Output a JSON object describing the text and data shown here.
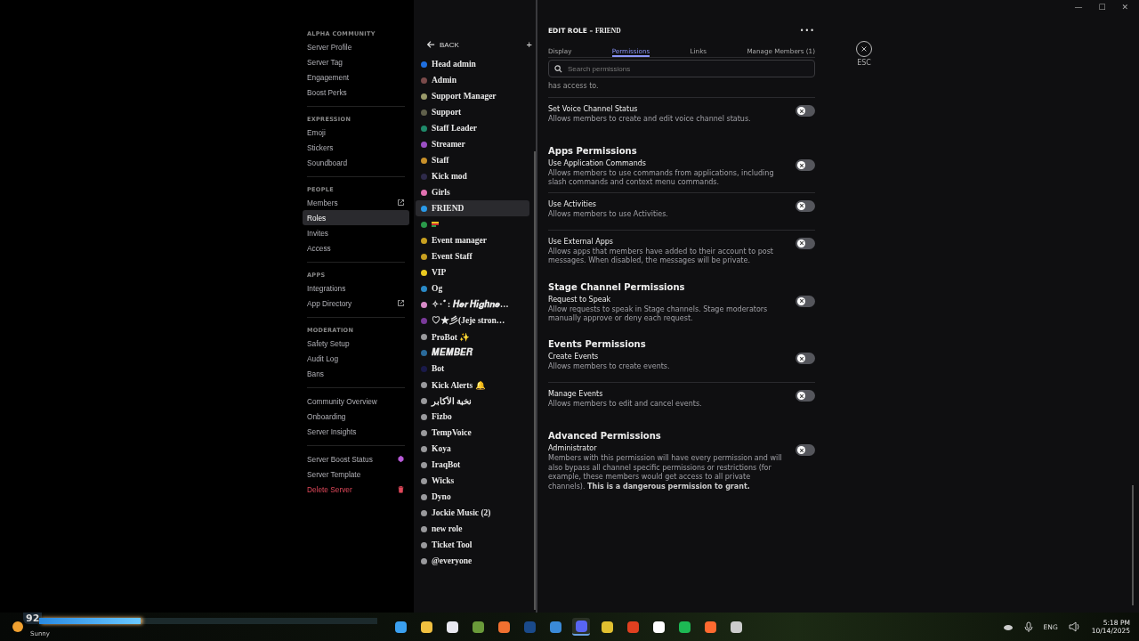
{
  "window_controls": [
    "—",
    "☐",
    "✕"
  ],
  "settings_nav": [
    {
      "header": "ALPHA COMMUNITY",
      "items": [
        {
          "label": "Server Profile",
          "kind": "link",
          "selected": false
        },
        {
          "label": "Server Tag",
          "kind": "link",
          "selected": false
        },
        {
          "label": "Engagement",
          "kind": "link",
          "selected": false
        },
        {
          "label": "Boost Perks",
          "kind": "link",
          "selected": false
        }
      ]
    },
    {
      "header": "EXPRESSION",
      "items": [
        {
          "label": "Emoji",
          "kind": "link",
          "selected": false
        },
        {
          "label": "Stickers",
          "kind": "link",
          "selected": false
        },
        {
          "label": "Soundboard",
          "kind": "link",
          "selected": false
        }
      ]
    },
    {
      "header": "PEOPLE",
      "items": [
        {
          "label": "Members",
          "kind": "external",
          "selected": false
        },
        {
          "label": "Roles",
          "kind": "link",
          "selected": true
        },
        {
          "label": "Invites",
          "kind": "link",
          "selected": false
        },
        {
          "label": "Access",
          "kind": "link",
          "selected": false
        }
      ]
    },
    {
      "header": "APPS",
      "items": [
        {
          "label": "Integrations",
          "kind": "link",
          "selected": false
        },
        {
          "label": "App Directory",
          "kind": "external",
          "selected": false
        }
      ]
    },
    {
      "header": "MODERATION",
      "items": [
        {
          "label": "Safety Setup",
          "kind": "link",
          "selected": false
        },
        {
          "label": "Audit Log",
          "kind": "link",
          "selected": false
        },
        {
          "label": "Bans",
          "kind": "link",
          "selected": false
        }
      ]
    },
    {
      "items": [
        {
          "label": "Community Overview",
          "kind": "link",
          "selected": false
        },
        {
          "label": "Onboarding",
          "kind": "link",
          "selected": false
        },
        {
          "label": "Server Insights",
          "kind": "link",
          "selected": false
        }
      ]
    },
    {
      "items": [
        {
          "label": "Server Boost Status",
          "kind": "boost",
          "selected": false
        },
        {
          "label": "Server Template",
          "kind": "link",
          "selected": false
        },
        {
          "label": "Delete Server",
          "kind": "danger",
          "selected": false
        }
      ]
    }
  ],
  "roles_panel": {
    "back": "BACK",
    "add": "+",
    "roles": [
      {
        "name": "Head admin",
        "color": "#1f6fe0",
        "selected": false,
        "kind": "text"
      },
      {
        "name": "Admin",
        "color": "#7a4a4a",
        "selected": false,
        "kind": "text"
      },
      {
        "name": "Support Manager",
        "color": "#9a9a6a",
        "selected": false,
        "kind": "text"
      },
      {
        "name": "Support",
        "color": "#5f5f4a",
        "selected": false,
        "kind": "text"
      },
      {
        "name": "Staff Leader",
        "color": "#1f8a6a",
        "selected": false,
        "kind": "text"
      },
      {
        "name": "Streamer",
        "color": "#9b4fc4",
        "selected": false,
        "kind": "text"
      },
      {
        "name": "Staff",
        "color": "#c8902a",
        "selected": false,
        "kind": "text"
      },
      {
        "name": "Kick mod",
        "color": "#2e2a4a",
        "selected": false,
        "kind": "text"
      },
      {
        "name": "Girls",
        "color": "#e070b0",
        "selected": false,
        "kind": "text"
      },
      {
        "name": "FRIEND",
        "color": "#2a9ae8",
        "selected": true,
        "kind": "text"
      },
      {
        "color": "#2a9a4a",
        "selected": false,
        "kind": "flag"
      },
      {
        "name": "Event manager",
        "color": "#c8a020",
        "selected": false,
        "kind": "text"
      },
      {
        "name": "Event Staff",
        "color": "#c8a020",
        "selected": false,
        "kind": "text"
      },
      {
        "name": "VIP",
        "color": "#e8c820",
        "selected": false,
        "kind": "text"
      },
      {
        "name": "Og",
        "color": "#2a8ac8",
        "selected": false,
        "kind": "text"
      },
      {
        "name": "✧･ﾟ: 𝑯𝒆𝒓 𝑯𝒊𝒈𝒉𝒏𝒆…",
        "color": "#d88ac8",
        "selected": false,
        "kind": "text"
      },
      {
        "name": "♡★彡(Jeje stron…",
        "color": "#7a3a9a",
        "selected": false,
        "kind": "text"
      },
      {
        "name": "ProBot ✨",
        "color": "#99999c",
        "selected": false,
        "kind": "text"
      },
      {
        "name": "𝑴𝑬𝑴𝑩𝑬𝑹",
        "color": "#2a6a9a",
        "selected": false,
        "kind": "text"
      },
      {
        "name": "Bot",
        "color": "#1a1a4a",
        "selected": false,
        "kind": "text"
      },
      {
        "name": "Kick Alerts 🔔",
        "color": "#99999c",
        "selected": false,
        "kind": "text"
      },
      {
        "name": "نخبة الأكابر",
        "color": "#99999c",
        "selected": false,
        "kind": "text"
      },
      {
        "name": "Fizbo",
        "color": "#99999c",
        "selected": false,
        "kind": "text"
      },
      {
        "name": "TempVoice",
        "color": "#99999c",
        "selected": false,
        "kind": "text"
      },
      {
        "name": "Koya",
        "color": "#99999c",
        "selected": false,
        "kind": "text"
      },
      {
        "name": "IraqBot",
        "color": "#99999c",
        "selected": false,
        "kind": "text"
      },
      {
        "name": "Wicks",
        "color": "#99999c",
        "selected": false,
        "kind": "text"
      },
      {
        "name": "Dyno",
        "color": "#99999c",
        "selected": false,
        "kind": "text"
      },
      {
        "name": "Jockie Music (2)",
        "color": "#99999c",
        "selected": false,
        "kind": "text"
      },
      {
        "name": "new role",
        "color": "#99999c",
        "selected": false,
        "kind": "text"
      },
      {
        "name": "Ticket Tool",
        "color": "#99999c",
        "selected": false,
        "kind": "text"
      },
      {
        "name": "@everyone",
        "color": "#99999c",
        "selected": false,
        "kind": "text"
      }
    ]
  },
  "edit_role": {
    "title_prefix": "EDIT ROLE – ",
    "role_name": "FRIEND",
    "more": "•••",
    "tabs": [
      {
        "label": "Display",
        "selected": false
      },
      {
        "label": "Permissions",
        "selected": true
      },
      {
        "label": "Links",
        "selected": false
      },
      {
        "label": "Manage Members (1)",
        "selected": false
      }
    ],
    "close": {
      "label": "ESC"
    },
    "search": {
      "placeholder": "Search permissions"
    },
    "lead_text": "has access to.",
    "sections": [
      {
        "items": [
          {
            "name": "Set Voice Channel Status",
            "description": "Allows members to create and edit voice channel status.",
            "on": false
          }
        ]
      },
      {
        "title": "Apps Permissions",
        "items": [
          {
            "name": "Use Application Commands",
            "description": "Allows members to use commands from applications, including slash commands and context menu commands.",
            "on": false
          },
          {
            "name": "Use Activities",
            "description": "Allows members to use Activities.",
            "on": false
          },
          {
            "name": "Use External Apps",
            "description": "Allows apps that members have added to their account to post messages. When disabled, the messages will be private.",
            "on": false
          }
        ]
      },
      {
        "title": "Stage Channel Permissions",
        "items": [
          {
            "name": "Request to Speak",
            "description": "Allow requests to speak in Stage channels. Stage moderators manually approve or deny each request.",
            "on": false
          }
        ]
      },
      {
        "title": "Events Permissions",
        "items": [
          {
            "name": "Create Events",
            "description": "Allows members to create events.",
            "on": false
          },
          {
            "name": "Manage Events",
            "description": "Allows members to edit and cancel events.",
            "on": false
          }
        ]
      },
      {
        "title": "Advanced Permissions",
        "items": [
          {
            "name": "Administrator",
            "description": "Members with this permission will have every permission and will also bypass all channel specific permissions or restrictions (for example, these members would get access to all private channels). **This is a dangerous permission to grant.**",
            "on": false
          }
        ]
      }
    ]
  },
  "taskbar": {
    "overlay": {
      "value": "92",
      "level": 0.3
    },
    "weather": {
      "condition": "Sunny"
    },
    "apps": [
      {
        "kind": "windows"
      },
      {
        "kind": "folder"
      },
      {
        "kind": "store"
      },
      {
        "kind": "v"
      },
      {
        "kind": "a"
      },
      {
        "kind": "steam"
      },
      {
        "kind": "shield"
      },
      {
        "kind": "discord",
        "selected": true
      },
      {
        "kind": "chrome"
      },
      {
        "kind": "ea"
      },
      {
        "kind": "m"
      },
      {
        "kind": "spotify"
      },
      {
        "kind": "ring"
      },
      {
        "kind": "obs"
      }
    ],
    "language": "ENG",
    "time": "5:18 PM",
    "date": "10/14/2025"
  }
}
